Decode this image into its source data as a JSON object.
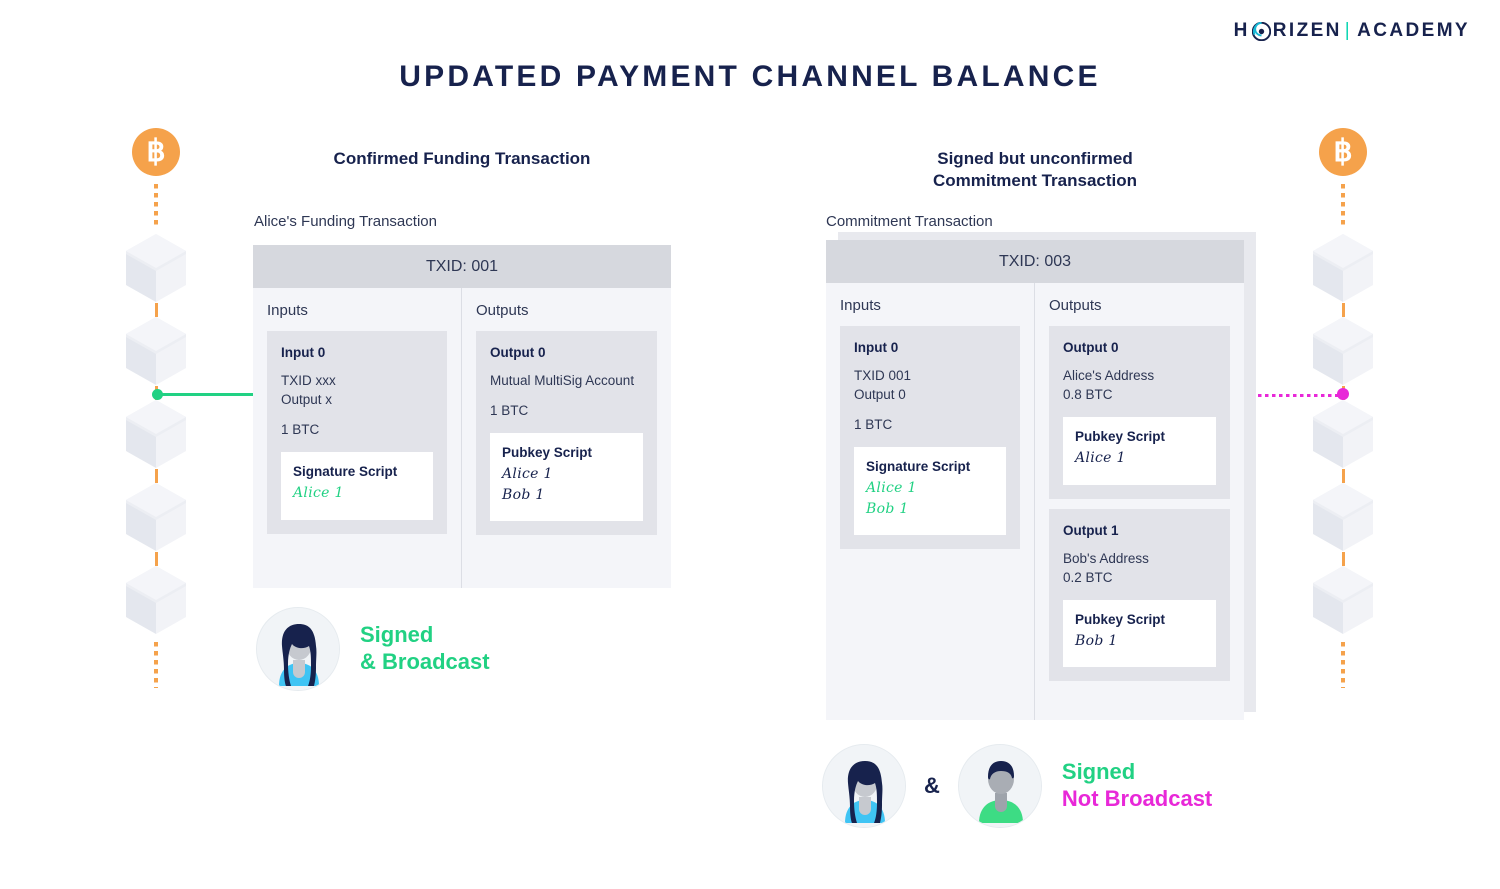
{
  "logo": {
    "before": "H",
    "o_icon": "horizen-o-icon",
    "after": "RIZEN",
    "separator": "|",
    "academy": "ACADEMY"
  },
  "title": "UPDATED PAYMENT CHANNEL BALANCE",
  "colors": {
    "navy": "#17224d",
    "green": "#21d183",
    "magenta": "#e828d8",
    "orange": "#f5a24b",
    "card_bg": "#f4f5f9",
    "card_header": "#d6d8de",
    "io_bg": "#e2e3e9",
    "script_bg": "#ffffff"
  },
  "chains": {
    "left": {
      "coin_symbol": "฿",
      "coin_name": "bitcoin-logo",
      "block_count": 5,
      "connector_block_index": 2,
      "connector_color": "#21d183",
      "connector_style": "solid"
    },
    "right": {
      "coin_symbol": "฿",
      "coin_name": "bitcoin-logo",
      "block_count": 5,
      "connector_block_index": 2,
      "connector_color": "#e828d8",
      "connector_style": "dotted"
    }
  },
  "left_panel": {
    "heading": "Confirmed Funding Transaction",
    "caption": "Alice's Funding Transaction",
    "txid": "TXID: 001",
    "inputs_title": "Inputs",
    "outputs_title": "Outputs",
    "inputs": [
      {
        "title": "Input 0",
        "lines": [
          "TXID xxx",
          "Output x"
        ],
        "amount": "1 BTC",
        "script": {
          "title": "Signature Script",
          "entries": [
            "Alice 1"
          ],
          "color": "green"
        }
      }
    ],
    "outputs": [
      {
        "title": "Output 0",
        "lines": [
          "Mutual MultiSig Account"
        ],
        "amount": "1 BTC",
        "script": {
          "title": "Pubkey Script",
          "entries": [
            "Alice 1",
            "Bob 1"
          ],
          "color": "navy"
        }
      }
    ],
    "status": {
      "avatar": "alice-avatar",
      "line1": "Signed",
      "line1_color": "green",
      "line2": "& Broadcast",
      "line2_color": "green"
    }
  },
  "right_panel": {
    "heading_line1": "Signed but unconfirmed",
    "heading_line2": "Commitment Transaction",
    "caption": "Commitment Transaction",
    "txid": "TXID: 003",
    "inputs_title": "Inputs",
    "outputs_title": "Outputs",
    "inputs": [
      {
        "title": "Input 0",
        "lines": [
          "TXID 001",
          "Output 0"
        ],
        "amount": "1 BTC",
        "script": {
          "title": "Signature Script",
          "entries": [
            "Alice 1",
            "Bob 1"
          ],
          "color": "green"
        }
      }
    ],
    "outputs": [
      {
        "title": "Output 0",
        "lines": [
          "Alice's Address",
          "0.8 BTC"
        ],
        "script": {
          "title": "Pubkey Script",
          "entries": [
            "Alice 1"
          ],
          "color": "navy"
        }
      },
      {
        "title": "Output 1",
        "lines": [
          "Bob's Address",
          "0.2 BTC"
        ],
        "script": {
          "title": "Pubkey Script",
          "entries": [
            "Bob 1"
          ],
          "color": "navy"
        }
      }
    ],
    "status": {
      "avatar_1": "alice-avatar",
      "conjunction": "&",
      "avatar_2": "bob-avatar",
      "line1": "Signed",
      "line1_color": "green",
      "line2": "Not Broadcast",
      "line2_color": "magenta"
    }
  }
}
